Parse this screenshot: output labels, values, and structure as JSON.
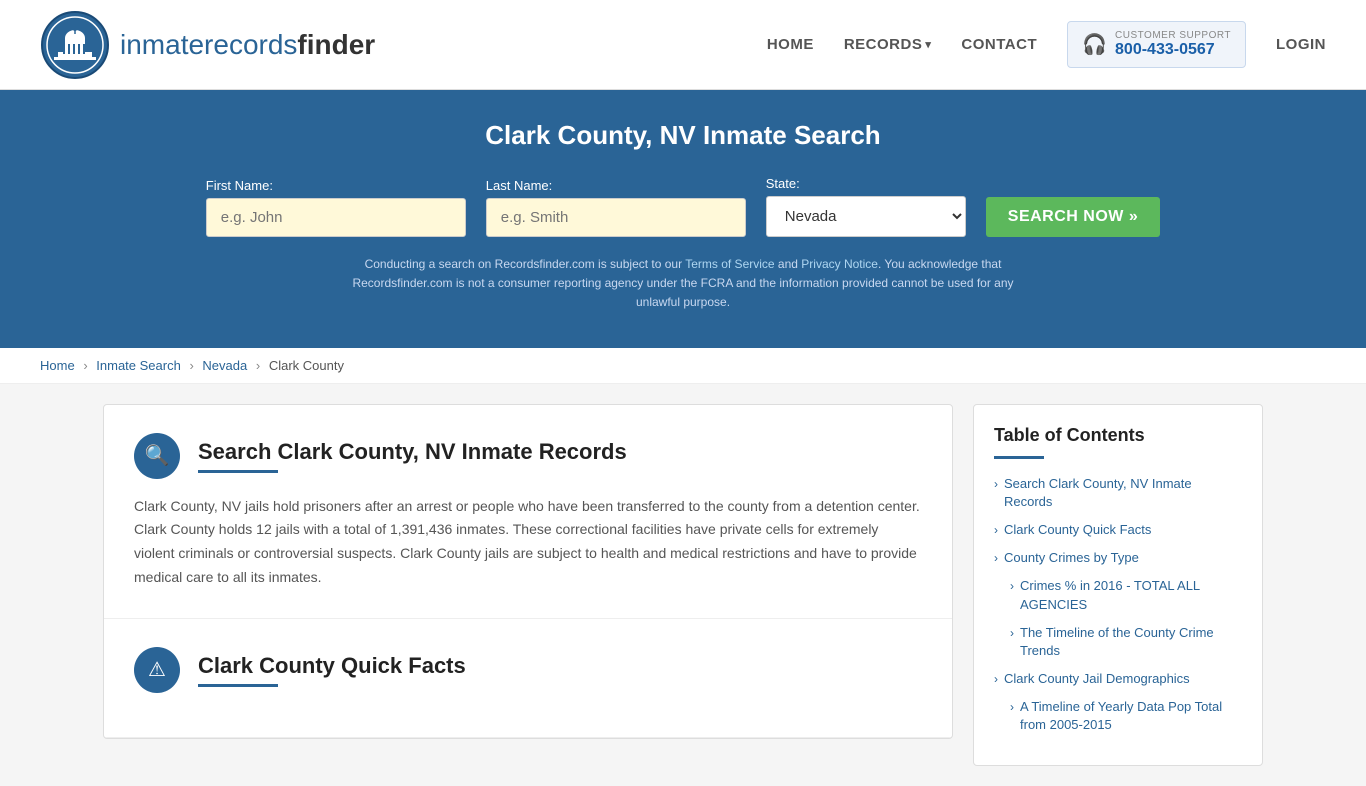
{
  "header": {
    "logo_text_part1": "inmaterecords",
    "logo_text_part2": "finder",
    "nav": [
      {
        "label": "HOME",
        "id": "nav-home"
      },
      {
        "label": "RECORDS",
        "id": "nav-records"
      },
      {
        "label": "CONTACT",
        "id": "nav-contact"
      }
    ],
    "support_label": "CUSTOMER SUPPORT",
    "support_number": "800-433-0567",
    "login_label": "LOGIN"
  },
  "hero": {
    "title": "Clark County, NV Inmate Search",
    "first_name_label": "First Name:",
    "first_name_placeholder": "e.g. John",
    "last_name_label": "Last Name:",
    "last_name_placeholder": "e.g. Smith",
    "state_label": "State:",
    "state_value": "Nevada",
    "search_button": "SEARCH NOW »",
    "disclaimer": "Conducting a search on Recordsfinder.com is subject to our Terms of Service and Privacy Notice. You acknowledge that Recordsfinder.com is not a consumer reporting agency under the FCRA and the information provided cannot be used for any unlawful purpose.",
    "tos_label": "Terms of Service",
    "privacy_label": "Privacy Notice"
  },
  "breadcrumb": {
    "items": [
      {
        "label": "Home",
        "href": "#"
      },
      {
        "label": "Inmate Search",
        "href": "#"
      },
      {
        "label": "Nevada",
        "href": "#"
      },
      {
        "label": "Clark County",
        "href": "#"
      }
    ]
  },
  "main_section": {
    "title": "Search Clark County, NV Inmate Records",
    "body": "Clark County, NV jails hold prisoners after an arrest or people who have been transferred to the county from a detention center. Clark County holds 12 jails with a total of 1,391,436 inmates. These correctional facilities have private cells for extremely violent criminals or controversial suspects. Clark County jails are subject to health and medical restrictions and have to provide medical care to all its inmates."
  },
  "quick_facts_section": {
    "title": "Clark County Quick Facts"
  },
  "toc": {
    "title": "Table of Contents",
    "items": [
      {
        "label": "Search Clark County, NV Inmate Records",
        "href": "#",
        "sub": false
      },
      {
        "label": "Clark County Quick Facts",
        "href": "#",
        "sub": false
      },
      {
        "label": "County Crimes by Type",
        "href": "#",
        "sub": false
      },
      {
        "label": "Crimes % in 2016 - TOTAL ALL AGENCIES",
        "href": "#",
        "sub": true
      },
      {
        "label": "The Timeline of the County Crime Trends",
        "href": "#",
        "sub": true
      },
      {
        "label": "Clark County Jail Demographics",
        "href": "#",
        "sub": false
      },
      {
        "label": "A Timeline of Yearly Data Pop Total from 2005-2015",
        "href": "#",
        "sub": true
      }
    ]
  }
}
